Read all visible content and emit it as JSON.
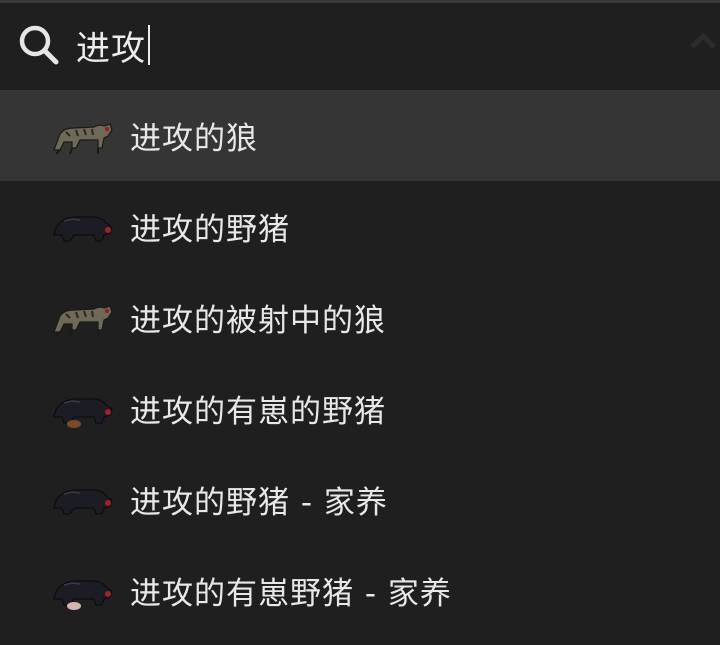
{
  "search": {
    "value": "进攻",
    "icon": "search-icon"
  },
  "colors": {
    "background": "#1f1f1f",
    "selected_row": "#353535",
    "text": "#e8e8e8"
  },
  "results": [
    {
      "label": "进攻的狼",
      "icon": "wolf-icon",
      "selected": true
    },
    {
      "label": "进攻的野猪",
      "icon": "boar-icon",
      "selected": false
    },
    {
      "label": "进攻的被射中的狼",
      "icon": "wolf-icon",
      "selected": false
    },
    {
      "label": "进攻的有崽的野猪",
      "icon": "boar-with-young-icon",
      "selected": false
    },
    {
      "label": "进攻的野猪 - 家养",
      "icon": "boar-icon",
      "selected": false
    },
    {
      "label": "进攻的有崽野猪 - 家养",
      "icon": "boar-with-young-icon",
      "selected": false
    }
  ]
}
